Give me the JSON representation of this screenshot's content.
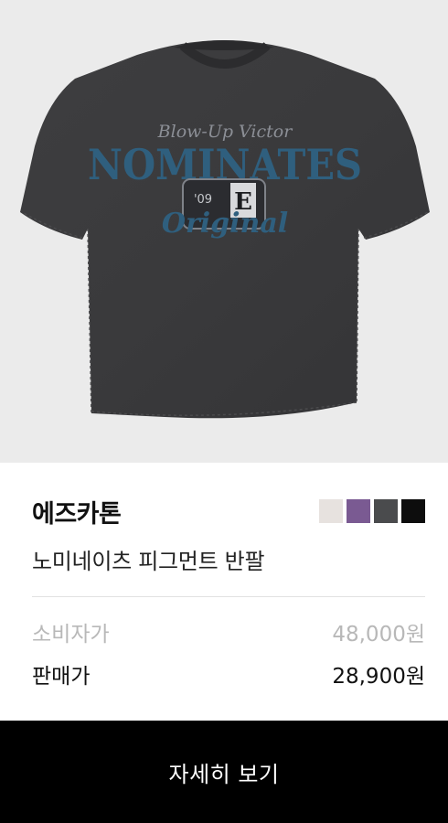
{
  "product": {
    "brand": "에즈카톤",
    "name": "노미네이츠 피그먼트 반팔",
    "image_alt": "Blow-Up Victor NOMINATES Original t-shirt",
    "print_text": {
      "script_top": "Blow-Up Victor",
      "headline": "NOMINATES",
      "badge_year": "'09",
      "badge_letter": "E",
      "script_bottom": "Original"
    },
    "colors": [
      {
        "name": "light-gray",
        "hex": "#e7e2df"
      },
      {
        "name": "purple",
        "hex": "#7a5a92"
      },
      {
        "name": "charcoal",
        "hex": "#4a4b4d"
      },
      {
        "name": "black",
        "hex": "#0d0d0d"
      }
    ]
  },
  "pricing": {
    "retail_label": "소비자가",
    "retail_price": "48,000원",
    "sale_label": "판매가",
    "sale_price": "28,900원"
  },
  "cta": {
    "label": "자세히 보기"
  }
}
